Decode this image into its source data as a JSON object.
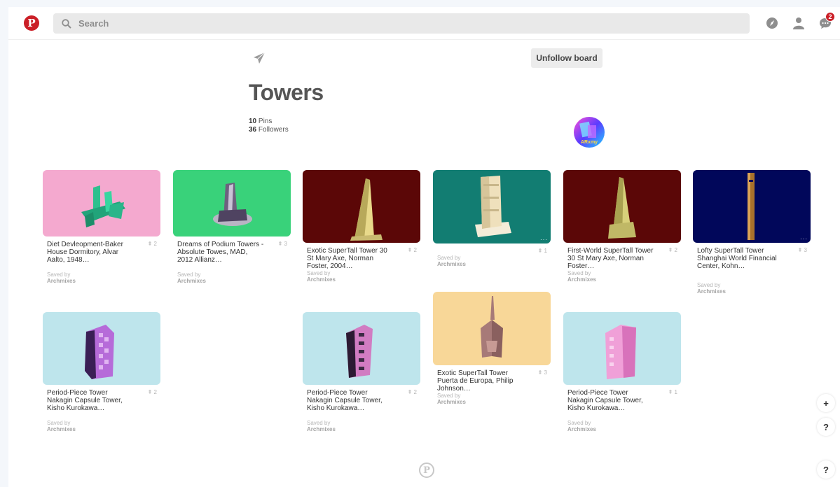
{
  "app": {
    "name": "Pinterest"
  },
  "colors": {
    "brand": "#cb1f27",
    "background": "#ffffff"
  },
  "header": {
    "search_placeholder": "Search",
    "notification_count": "2",
    "icons": [
      "pinterest-logo-icon",
      "search-icon",
      "explore-compass-icon",
      "profile-icon",
      "messages-icon"
    ]
  },
  "board": {
    "title": "Towers",
    "pins_count": "10",
    "pins_label": " Pins",
    "followers_count": "36",
    "followers_label": " Followers",
    "unfollow_label": "Unfollow board",
    "owner_avatar_text": "ARxmy"
  },
  "pins": [
    {
      "description": "Diet Devleopment-Baker House Dormitory, Alvar Aalto, 1948…",
      "saves": "2",
      "saved_by_label": "Saved by",
      "saved_by": "Archmixes",
      "bg": "#f4a9cf",
      "color": "#2ec08e"
    },
    {
      "description": "Dreams of Podium Towers - Absolute Towes, MAD, 2012 Allianz…",
      "saves": "3",
      "saved_by_label": "Saved by",
      "saved_by": "Archmixes",
      "bg": "#39d27a",
      "color": "#5c4d73"
    },
    {
      "description": "Exotic SuperTall Tower 30 St Mary Axe, Norman Foster, 2004…",
      "saves": "2",
      "saved_by_label": "Saved by",
      "saved_by": "Archmixes",
      "bg": "#5b0707",
      "color": "#e8d98a"
    },
    {
      "description": "",
      "saves": "1",
      "saved_by_label": "Saved by",
      "saved_by": "Archmixes",
      "bg": "#127d72",
      "color": "#f1e3c0"
    },
    {
      "description": "First-World SuperTall Tower 30 St Mary Axe, Norman Foster…",
      "saves": "2",
      "saved_by_label": "Saved by",
      "saved_by": "Archmixes",
      "bg": "#5b0707",
      "color": "#d8d07a"
    },
    {
      "description": "Lofty SuperTall Tower Shanghai World Financial Center, Kohn…",
      "saves": "3",
      "saved_by_label": "Saved by",
      "saved_by": "Archmixes",
      "bg": "#01075a",
      "color": "#d9a255"
    },
    {
      "description": "Period-Piece Tower Nakagin Capsule Tower, Kisho Kurokawa…",
      "saves": "2",
      "saved_by_label": "Saved by",
      "saved_by": "Archmixes",
      "bg": "#bee5ec",
      "color": "#b66bd9"
    },
    {
      "description": "Period-Piece Tower Nakagin Capsule Tower, Kisho Kurokawa…",
      "saves": "2",
      "saved_by_label": "Saved by",
      "saved_by": "Archmixes",
      "bg": "#bee5ec",
      "color": "#d17cc2"
    },
    {
      "description": "Exotic SuperTall Tower Puerta de Europa, Philip Johnson…",
      "saves": "3",
      "saved_by_label": "Saved by",
      "saved_by": "Archmixes",
      "bg": "#f8d798",
      "color": "#a77a78"
    },
    {
      "description": "Period-Piece Tower Nakagin Capsule Tower, Kisho Kurokawa…",
      "saves": "1",
      "saved_by_label": "Saved by",
      "saved_by": "Archmixes",
      "bg": "#bee5ec",
      "color": "#f0a0d8"
    }
  ],
  "floating": {
    "add_label": "+",
    "help_label": "?",
    "help2_label": "?"
  }
}
